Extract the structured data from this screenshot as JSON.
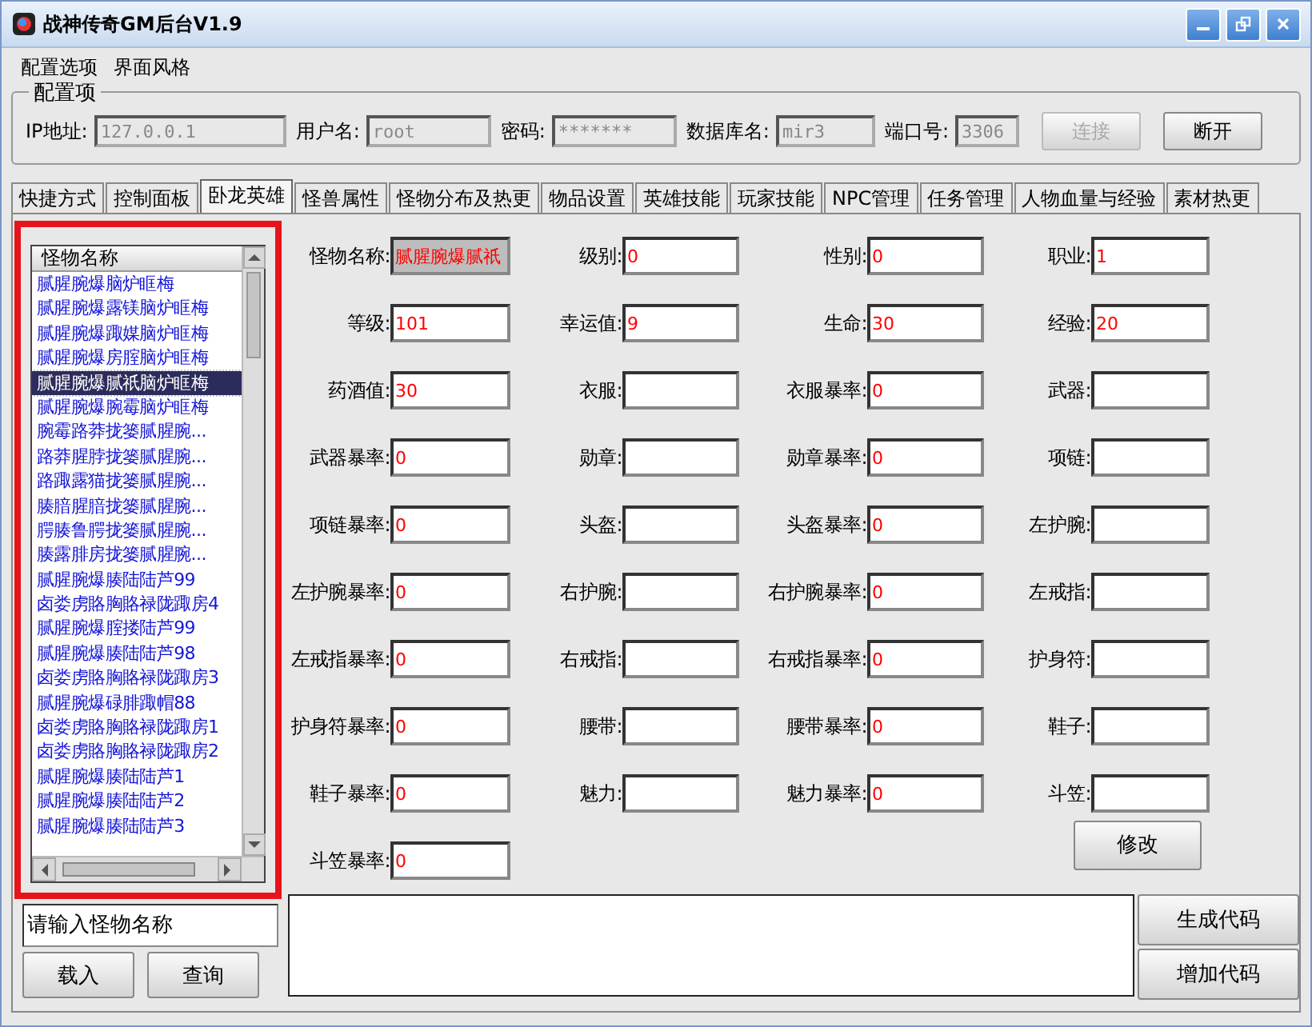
{
  "window": {
    "title": "战神传奇GM后台V1.9"
  },
  "menu": [
    "配置选项",
    "界面风格"
  ],
  "config": {
    "title": "配置项",
    "fields": [
      {
        "label": "IP地址:",
        "value": "127.0.0.1"
      },
      {
        "label": "用户名:",
        "value": "root"
      },
      {
        "label": "密码:",
        "value": "*******"
      },
      {
        "label": "数据库名:",
        "value": "mir3"
      },
      {
        "label": "端口号:",
        "value": "3306"
      }
    ],
    "buttons": [
      {
        "label": "连接",
        "disabled": true
      },
      {
        "label": "断开",
        "disabled": false
      }
    ]
  },
  "tabs": [
    {
      "label": "快捷方式",
      "selected": false
    },
    {
      "label": "控制面板",
      "selected": false
    },
    {
      "label": "卧龙英雄",
      "selected": true
    },
    {
      "label": "怪兽属性",
      "selected": false
    },
    {
      "label": "怪物分布及热更",
      "selected": false
    },
    {
      "label": "物品设置",
      "selected": false
    },
    {
      "label": "英雄技能",
      "selected": false
    },
    {
      "label": "玩家技能",
      "selected": false
    },
    {
      "label": "NPC管理",
      "selected": false
    },
    {
      "label": "任务管理",
      "selected": false
    },
    {
      "label": "人物血量与经验",
      "selected": false
    },
    {
      "label": "素材热更",
      "selected": false
    }
  ],
  "monster_list": {
    "header": "怪物名称",
    "items": [
      {
        "name": "腻腥腕爆脑炉眶梅",
        "selected": false
      },
      {
        "name": "腻腥腕爆露镁脑炉眶梅",
        "selected": false
      },
      {
        "name": "腻腥腕爆踙媒脑炉眶梅",
        "selected": false
      },
      {
        "name": "腻腥腕爆房腟脑炉眶梅",
        "selected": false
      },
      {
        "name": "腻腥腕爆腻祇脑炉眶梅",
        "selected": true
      },
      {
        "name": "腻腥腕爆腕霉脑炉眶梅",
        "selected": false
      },
      {
        "name": "腕霉路莽拢篓腻腥腕...",
        "selected": false
      },
      {
        "name": "路莽腥脖拢篓腻腥腕...",
        "selected": false
      },
      {
        "name": "路踙露猫拢篓腻腥腕...",
        "selected": false
      },
      {
        "name": "腠腤腥腤拢篓腻腥腕...",
        "selected": false
      },
      {
        "name": "腭腠鲁腭拢篓腻腥腕...",
        "selected": false
      },
      {
        "name": "腠露腓房拢篓腻腥腕...",
        "selected": false
      },
      {
        "name": "腻腥腕爆腠陆陆芦99",
        "selected": false
      },
      {
        "name": "卤娄虏賂胸賂禄陇踙房4",
        "selected": false
      },
      {
        "name": "腻腥腕爆腟搂陆芦99",
        "selected": false
      },
      {
        "name": "腻腥腕爆腠陆陆芦98",
        "selected": false
      },
      {
        "name": "卤娄虏賂胸賂禄陇踙房3",
        "selected": false
      },
      {
        "name": "腻腥腕爆碌腓踙帽88",
        "selected": false
      },
      {
        "name": "卤娄虏賂胸賂禄陇踙房1",
        "selected": false
      },
      {
        "name": "卤娄虏賂胸賂禄陇踙房2",
        "selected": false
      },
      {
        "name": "腻腥腕爆腠陆陆芦1",
        "selected": false
      },
      {
        "name": "腻腥腕爆腠陆陆芦2",
        "selected": false
      },
      {
        "name": "腻腥腕爆腠陆陆芦3",
        "selected": false
      }
    ],
    "search": {
      "placeholder": "请输入怪物名称"
    },
    "buttons": [
      "载入",
      "查询"
    ]
  },
  "fields": [
    {
      "label": "怪物名称:",
      "value": "腻腥腕爆腻祇",
      "readonly": true
    },
    {
      "label": "级别:",
      "value": "0"
    },
    {
      "label": "性别:",
      "value": "0"
    },
    {
      "label": "职业:",
      "value": "1"
    },
    {
      "label": "等级:",
      "value": "101"
    },
    {
      "label": "幸运值:",
      "value": "9"
    },
    {
      "label": "生命:",
      "value": "30"
    },
    {
      "label": "经验:",
      "value": "20"
    },
    {
      "label": "药酒值:",
      "value": "30"
    },
    {
      "label": "衣服:"
    },
    {
      "label": "衣服暴率:",
      "value": "0"
    },
    {
      "label": "武器:"
    },
    {
      "label": "武器暴率:",
      "value": "0"
    },
    {
      "label": "勋章:"
    },
    {
      "label": "勋章暴率:",
      "value": "0"
    },
    {
      "label": "项链:"
    },
    {
      "label": "项链暴率:",
      "value": "0"
    },
    {
      "label": "头盔:"
    },
    {
      "label": "头盔暴率:",
      "value": "0"
    },
    {
      "label": "左护腕:"
    },
    {
      "label": "左护腕暴率:",
      "value": "0"
    },
    {
      "label": "右护腕:"
    },
    {
      "label": "右护腕暴率:",
      "value": "0"
    },
    {
      "label": "左戒指:"
    },
    {
      "label": "左戒指暴率:",
      "value": "0"
    },
    {
      "label": "右戒指:"
    },
    {
      "label": "右戒指暴率:",
      "value": "0"
    },
    {
      "label": "护身符:"
    },
    {
      "label": "护身符暴率:",
      "value": "0"
    },
    {
      "label": "腰带:"
    },
    {
      "label": "腰带暴率:",
      "value": "0"
    },
    {
      "label": "鞋子:"
    },
    {
      "label": "鞋子暴率:",
      "value": "0"
    },
    {
      "label": "魅力:"
    },
    {
      "label": "魅力暴率:",
      "value": "0"
    },
    {
      "label": "斗笠:"
    },
    {
      "label": "斗笠暴率:",
      "value": "0"
    }
  ],
  "modify_button": "修改",
  "code_buttons": [
    "生成代码",
    "增加代码"
  ]
}
